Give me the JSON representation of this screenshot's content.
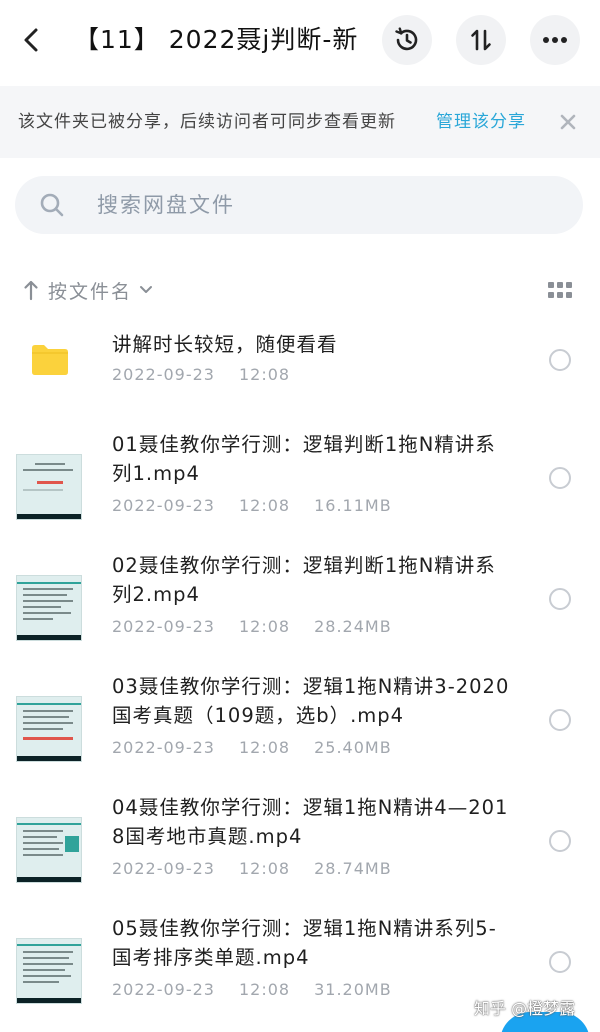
{
  "header": {
    "title": "【11】 2022聂j判断-新"
  },
  "banner": {
    "text": "该文件夹已被分享，后续访问者可同步查看更新",
    "link": "管理该分享"
  },
  "search": {
    "placeholder": "搜索网盘文件"
  },
  "sort": {
    "label": "按文件名"
  },
  "files": [
    {
      "type": "folder",
      "name": "讲解时长较短，随便看看",
      "date": "2022-09-23",
      "time": "12:08",
      "size": ""
    },
    {
      "type": "video",
      "name": "01聂佳教你学行测：逻辑判断1拖N精讲系列1.mp4",
      "date": "2022-09-23",
      "time": "12:08",
      "size": "16.11MB"
    },
    {
      "type": "video",
      "name": "02聂佳教你学行测：逻辑判断1拖N精讲系列2.mp4",
      "date": "2022-09-23",
      "time": "12:08",
      "size": "28.24MB"
    },
    {
      "type": "video",
      "name": "03聂佳教你学行测：逻辑1拖N精讲3-2020国考真题（109题，选b）.mp4",
      "date": "2022-09-23",
      "time": "12:08",
      "size": "25.40MB"
    },
    {
      "type": "video",
      "name": "04聂佳教你学行测：逻辑1拖N精讲4—2018国考地市真题.mp4",
      "date": "2022-09-23",
      "time": "12:08",
      "size": "28.74MB"
    },
    {
      "type": "video",
      "name": "05聂佳教你学行测：逻辑1拖N精讲系列5-国考排序类单题.mp4",
      "date": "2022-09-23",
      "time": "12:08",
      "size": "31.20MB"
    }
  ],
  "watermark": {
    "text": "知乎 @橙梦露"
  },
  "colors": {
    "accent": "#2aa7d8",
    "folder": "#fbd23c",
    "fab": "#1aa3f0"
  }
}
